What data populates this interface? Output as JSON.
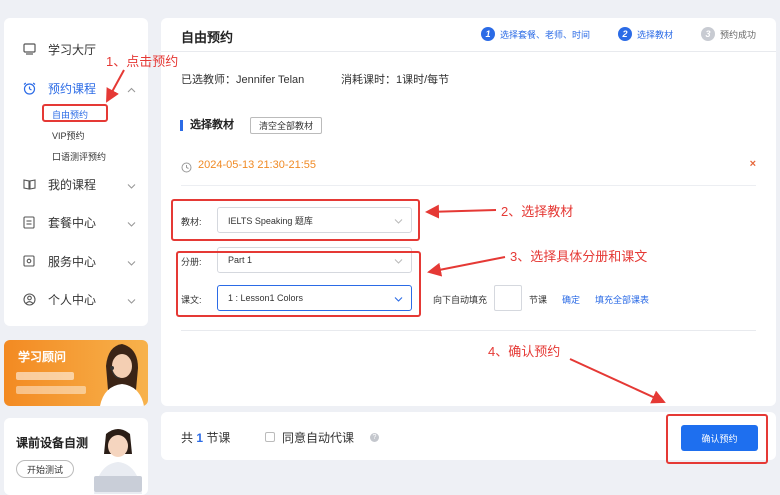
{
  "sidebar": {
    "items": [
      {
        "label": "学习大厅",
        "icon": "monitor-icon"
      },
      {
        "label": "预约课程",
        "icon": "alarm-clock-icon"
      },
      {
        "label": "我的课程",
        "icon": "book-icon"
      },
      {
        "label": "套餐中心",
        "icon": "package-icon"
      },
      {
        "label": "服务中心",
        "icon": "service-icon"
      },
      {
        "label": "个人中心",
        "icon": "user-icon"
      }
    ],
    "sub_items": [
      "自由预约",
      "VIP预约",
      "口语测评预约"
    ],
    "advisor_title": "学习顾问",
    "device_title": "课前设备自测",
    "device_button": "开始测试"
  },
  "header": {
    "title": "自由预约",
    "steps": [
      {
        "num": "1",
        "label": "选择套餐、老师、时间"
      },
      {
        "num": "2",
        "label": "选择教材"
      },
      {
        "num": "3",
        "label": "预约成功"
      }
    ]
  },
  "info": {
    "teacher": "已选教师：Jennifer Telan",
    "cost": "消耗课时：1课时/每节"
  },
  "materials": {
    "section_title": "选择教材",
    "clear_button": "清空全部教材",
    "session_time": "2024-05-13 21:30-21:55",
    "close_symbol": "×",
    "textbook_label": "教材:",
    "textbook_value": "IELTS Speaking 题库",
    "volume_label": "分册:",
    "volume_value": "Part 1",
    "lesson_label": "课文:",
    "lesson_value": "1 : Lesson1 Colors",
    "autofill_label": "向下自动填充",
    "unit": "节课",
    "confirm_link": "确定",
    "fill_all_link": "填充全部课表"
  },
  "footer": {
    "total_prefix": "共",
    "total_count": "1",
    "total_suffix": "节课",
    "agree_label": "同意自动代课",
    "help_symbol": "?",
    "confirm_button": "确认预约"
  },
  "annotations": {
    "a1": "1、点击预约",
    "a2": "2、选择教材",
    "a3": "3、选择具体分册和课文",
    "a4": "4、确认预约"
  },
  "colors": {
    "accent": "#2b6be6",
    "annotation": "#e53935",
    "session_time": "#f08a24"
  }
}
